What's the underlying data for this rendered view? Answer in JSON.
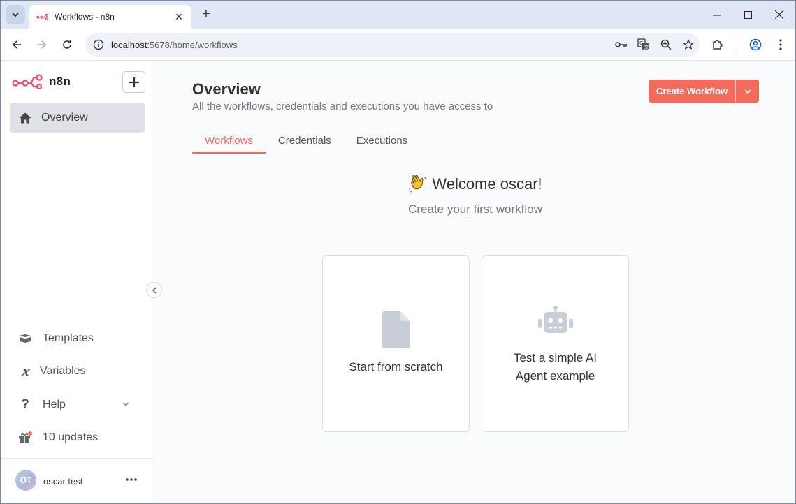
{
  "browser": {
    "tab_title": "Workflows - n8n",
    "url_host": "localhost",
    "url_path": ":5678/home/workflows"
  },
  "sidebar": {
    "logo_text": "n8n",
    "overview_label": "Overview",
    "items": [
      {
        "label": "Templates",
        "icon": "templates-icon"
      },
      {
        "label": "Variables",
        "icon": "variables-icon"
      },
      {
        "label": "Help",
        "icon": "help-icon"
      },
      {
        "label": "10 updates",
        "icon": "gift-icon"
      }
    ],
    "user": {
      "initials": "OT",
      "name": "oscar test"
    }
  },
  "main": {
    "title": "Overview",
    "subtitle": "All the workflows, credentials and executions you have access to",
    "create_button": "Create Workflow",
    "tabs": [
      {
        "label": "Workflows",
        "active": true
      },
      {
        "label": "Credentials",
        "active": false
      },
      {
        "label": "Executions",
        "active": false
      }
    ],
    "welcome": "Welcome oscar!",
    "welcome_sub": "Create your first workflow",
    "cards": [
      {
        "label": "Start from scratch",
        "icon": "file-icon"
      },
      {
        "label_line1": "Test a simple AI",
        "label_line2": "Agent example",
        "icon": "robot-icon"
      }
    ]
  },
  "colors": {
    "accent": "#f26c59",
    "logo": "#ea4b71"
  }
}
